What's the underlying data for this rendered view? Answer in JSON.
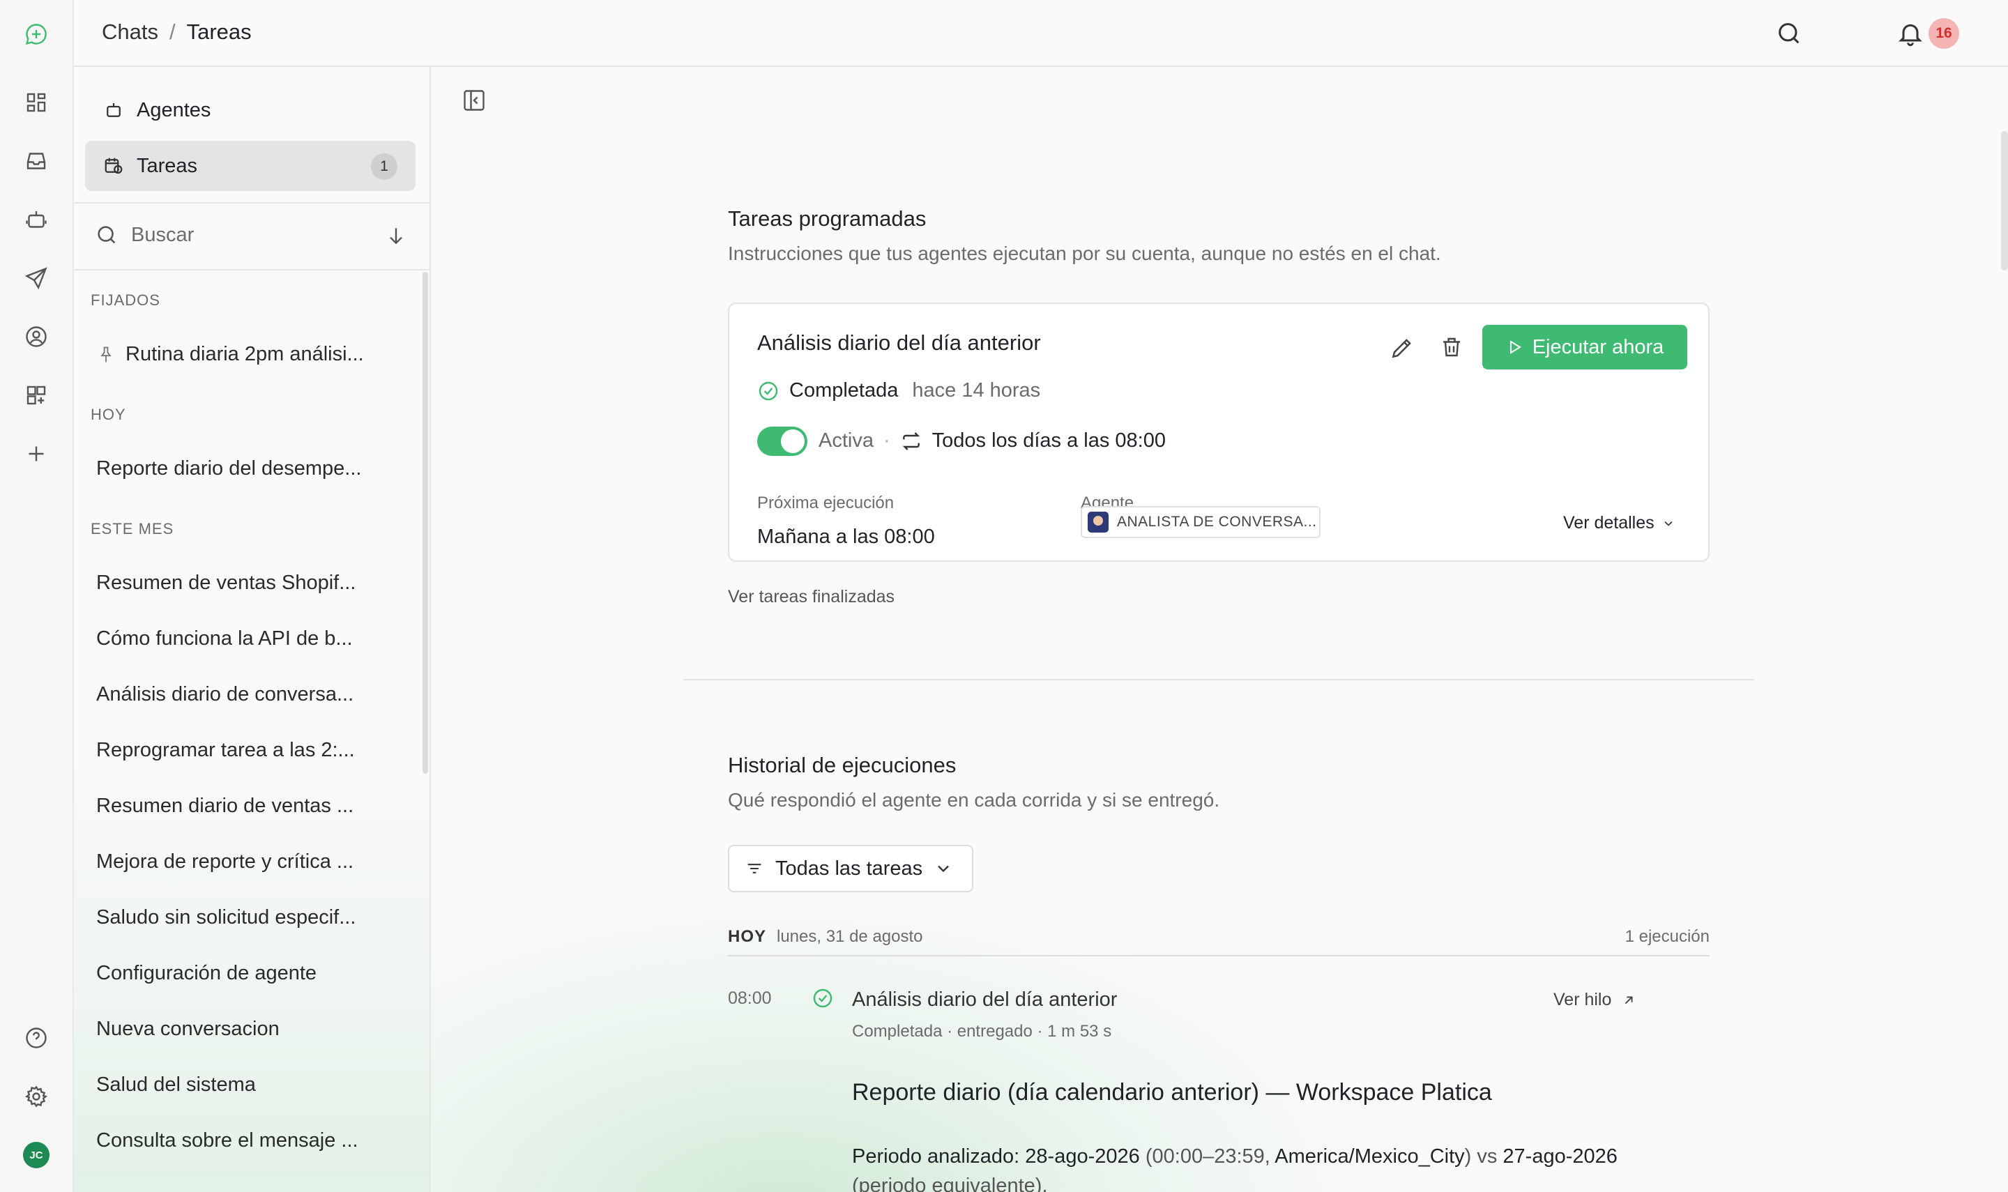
{
  "header": {
    "breadcrumb": [
      "Chats",
      "Tareas"
    ],
    "separator": "/",
    "notification_count": "16"
  },
  "rail": {
    "icons": [
      "logo-chat-icon",
      "dashboard-icon",
      "inbox-icon",
      "bot-icon",
      "send-icon",
      "contact-icon",
      "apps-add-icon",
      "plus-icon",
      "help-icon",
      "settings-icon"
    ],
    "user_initials": "JC"
  },
  "sidebar": {
    "nav": [
      {
        "label": "Agentes",
        "icon": "bot-icon"
      },
      {
        "label": "Tareas",
        "icon": "calendar-clock-icon",
        "count": "1"
      }
    ],
    "search_placeholder": "Buscar",
    "sections": {
      "pinned": "FIJADOS",
      "today": "HOY",
      "month": "ESTE MES"
    },
    "pinned": [
      "Rutina diaria 2pm análisi..."
    ],
    "today": [
      "Reporte diario del desempe..."
    ],
    "month": [
      "Resumen de ventas Shopif...",
      "Cómo funciona la API de b...",
      "Análisis diario de conversa...",
      "Reprogramar tarea a las 2:...",
      "Resumen diario de ventas ...",
      "Mejora de reporte y crítica ...",
      "Saludo sin solicitud especif...",
      "Configuración de agente",
      "Nueva conversacion",
      "Salud del sistema",
      "Consulta sobre el mensaje ..."
    ]
  },
  "scheduled": {
    "title": "Tareas programadas",
    "subtitle": "Instrucciones que tus agentes ejecutan por su cuenta, aunque no estés en el chat.",
    "card": {
      "title": "Análisis diario del día anterior",
      "run_label": "Ejecutar ahora",
      "status": "Completada",
      "status_time": "hace 14 horas",
      "active_label": "Activa",
      "active_sep": "·",
      "schedule": "Todos los días a las 08:00",
      "next_label": "Próxima ejecución",
      "next_value": "Mañana a las 08:00",
      "agent_label": "Agente",
      "agent_name": "ANALISTA DE CONVERSA...",
      "details_label": "Ver detalles"
    },
    "finished_link": "Ver tareas finalizadas"
  },
  "history": {
    "title": "Historial de ejecuciones",
    "subtitle": "Qué respondió el agente en cada corrida y si se entregó.",
    "filter_label": "Todas las tareas",
    "day": {
      "tag": "HOY",
      "date": "lunes, 31 de agosto",
      "count": "1 ejecución"
    },
    "run": {
      "time": "08:00",
      "title": "Análisis diario del día anterior",
      "meta": "Completada · entregado · 1 m 53 s",
      "thread_label": "Ver hilo",
      "report_title": "Reporte diario (día calendario anterior) — Workspace Platica",
      "period_label": "Periodo analizado:",
      "period_date": "28-ago-2026",
      "period_range": "(00:00–23:59,",
      "period_tz": "America/Mexico_City",
      "period_vs": ") vs",
      "period_compare": "27-ago-2026",
      "period_equiv": "(periodo equivalente)."
    }
  }
}
